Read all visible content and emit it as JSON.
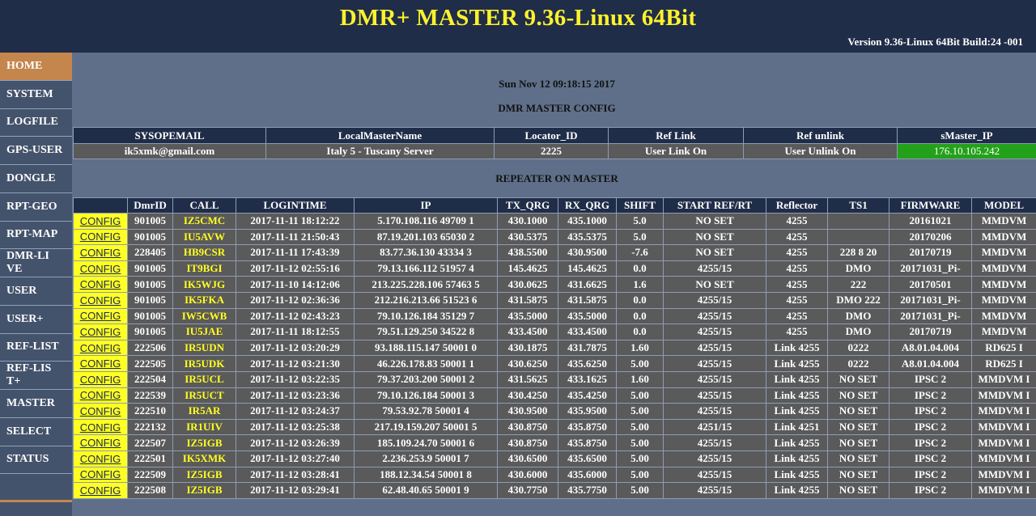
{
  "header": {
    "title": "DMR+ MASTER 9.36-Linux 64Bit",
    "version": "Version 9.36-Linux 64Bit Build:24 -001"
  },
  "nav": [
    {
      "label": "HOME",
      "active": true
    },
    {
      "label": "SYSTEM"
    },
    {
      "label": "LOGFILE"
    },
    {
      "label": "GPS-USER"
    },
    {
      "label": "DONGLE"
    },
    {
      "label": "RPT-GEO"
    },
    {
      "label": "RPT-MAP"
    },
    {
      "label": "DMR-LIVE"
    },
    {
      "label": "USER"
    },
    {
      "label": "USER+"
    },
    {
      "label": "REF-LIST"
    },
    {
      "label": "REF-LIST+"
    },
    {
      "label": "MASTER"
    },
    {
      "label": "SELECT"
    },
    {
      "label": "STATUS"
    }
  ],
  "main": {
    "datetime": "Sun Nov 12 09:18:15 2017",
    "config_title": "DMR MASTER CONFIG",
    "repeater_title": "REPEATER ON MASTER"
  },
  "config_table": {
    "headers": [
      "SYSOPEMAIL",
      "LocalMasterName",
      "Locator_ID",
      "Ref Link",
      "Ref unlink",
      "sMaster_IP"
    ],
    "row": [
      "ik5xmk@gmail.com",
      "Italy 5 - Tuscany Server",
      "2225",
      "User Link On",
      "User Unlink On",
      "176.10.105.242"
    ]
  },
  "repeater_table": {
    "headers": [
      "",
      "DmrID",
      "CALL",
      "LOGINTIME",
      "IP",
      "TX_QRG",
      "RX_QRG",
      "SHIFT",
      "START REF/RT",
      "Reflector",
      "TS1",
      "FIRMWARE",
      "MODEL"
    ],
    "config_label": "CONFIG",
    "rows": [
      [
        "901005",
        "IZ5CMC",
        "2017-11-11 18:12:22",
        "5.170.108.116 49709 1",
        "430.1000",
        "435.1000",
        "5.0",
        "NO SET",
        "4255",
        "",
        "20161021",
        "MMDVM"
      ],
      [
        "901005",
        "IU5AVW",
        "2017-11-11 21:50:43",
        "87.19.201.103 65030 2",
        "430.5375",
        "435.5375",
        "5.0",
        "NO SET",
        "4255",
        "",
        "20170206",
        "MMDVM"
      ],
      [
        "228405",
        "HB9CSR",
        "2017-11-11 17:43:39",
        "83.77.36.130 43334 3",
        "438.5500",
        "430.9500",
        "-7.6",
        "NO SET",
        "4255",
        "228 8 20",
        "20170719",
        "MMDVM"
      ],
      [
        "901005",
        "IT9BGI",
        "2017-11-12 02:55:16",
        "79.13.166.112 51957 4",
        "145.4625",
        "145.4625",
        "0.0",
        "4255/15",
        "4255",
        "DMO",
        "20171031_Pi-",
        "MMDVM"
      ],
      [
        "901005",
        "IK5WJG",
        "2017-11-10 14:12:06",
        "213.225.228.106 57463 5",
        "430.0625",
        "431.6625",
        "1.6",
        "NO SET",
        "4255",
        "222",
        "20170501",
        "MMDVM"
      ],
      [
        "901005",
        "IK5FKA",
        "2017-11-12 02:36:36",
        "212.216.213.66 51523 6",
        "431.5875",
        "431.5875",
        "0.0",
        "4255/15",
        "4255",
        "DMO 222",
        "20171031_Pi-",
        "MMDVM"
      ],
      [
        "901005",
        "IW5CWB",
        "2017-11-12 02:43:23",
        "79.10.126.184 35129 7",
        "435.5000",
        "435.5000",
        "0.0",
        "4255/15",
        "4255",
        "DMO",
        "20171031_Pi-",
        "MMDVM"
      ],
      [
        "901005",
        "IU5JAE",
        "2017-11-11 18:12:55",
        "79.51.129.250 34522 8",
        "433.4500",
        "433.4500",
        "0.0",
        "4255/15",
        "4255",
        "DMO",
        "20170719",
        "MMDVM"
      ],
      [
        "222506",
        "IR5UDN",
        "2017-11-12 03:20:29",
        "93.188.115.147 50001 0",
        "430.1875",
        "431.7875",
        "1.60",
        "4255/15",
        "Link 4255",
        "0222",
        "A8.01.04.004",
        "RD625 I"
      ],
      [
        "222505",
        "IR5UDK",
        "2017-11-12 03:21:30",
        "46.226.178.83 50001 1",
        "430.6250",
        "435.6250",
        "5.00",
        "4255/15",
        "Link 4255",
        "0222",
        "A8.01.04.004",
        "RD625 I"
      ],
      [
        "222504",
        "IR5UCL",
        "2017-11-12 03:22:35",
        "79.37.203.200 50001 2",
        "431.5625",
        "433.1625",
        "1.60",
        "4255/15",
        "Link 4255",
        "NO SET",
        "IPSC 2",
        "MMDVM I"
      ],
      [
        "222539",
        "IR5UCT",
        "2017-11-12 03:23:36",
        "79.10.126.184 50001 3",
        "430.4250",
        "435.4250",
        "5.00",
        "4255/15",
        "Link 4255",
        "NO SET",
        "IPSC 2",
        "MMDVM I"
      ],
      [
        "222510",
        "IR5AR",
        "2017-11-12 03:24:37",
        "79.53.92.78 50001 4",
        "430.9500",
        "435.9500",
        "5.00",
        "4255/15",
        "Link 4255",
        "NO SET",
        "IPSC 2",
        "MMDVM I"
      ],
      [
        "222132",
        "IR1UIV",
        "2017-11-12 03:25:38",
        "217.19.159.207 50001 5",
        "430.8750",
        "435.8750",
        "5.00",
        "4251/15",
        "Link 4251",
        "NO SET",
        "IPSC 2",
        "MMDVM I"
      ],
      [
        "222507",
        "IZ5IGB",
        "2017-11-12 03:26:39",
        "185.109.24.70 50001 6",
        "430.8750",
        "435.8750",
        "5.00",
        "4255/15",
        "Link 4255",
        "NO SET",
        "IPSC 2",
        "MMDVM I"
      ],
      [
        "222501",
        "IK5XMK",
        "2017-11-12 03:27:40",
        "2.236.253.9 50001 7",
        "430.6500",
        "435.6500",
        "5.00",
        "4255/15",
        "Link 4255",
        "NO SET",
        "IPSC 2",
        "MMDVM I"
      ],
      [
        "222509",
        "IZ5IGB",
        "2017-11-12 03:28:41",
        "188.12.34.54 50001 8",
        "430.6000",
        "435.6000",
        "5.00",
        "4255/15",
        "Link 4255",
        "NO SET",
        "IPSC 2",
        "MMDVM I"
      ],
      [
        "222508",
        "IZ5IGB",
        "2017-11-12 03:29:41",
        "62.48.40.65 50001 9",
        "430.7750",
        "435.7750",
        "5.00",
        "4255/15",
        "Link 4255",
        "NO SET",
        "IPSC 2",
        "MMDVM I"
      ]
    ]
  },
  "colors": {
    "header_bg": "#1f2d48",
    "title_yellow": "#fff22b",
    "page_bg": "#5f6f89",
    "sidebar_bg": "#44536c",
    "active_nav": "#c4864d",
    "cell_bg": "#5a5a5a",
    "ip_green": "#23a11a",
    "config_yellow": "#ffff22"
  }
}
